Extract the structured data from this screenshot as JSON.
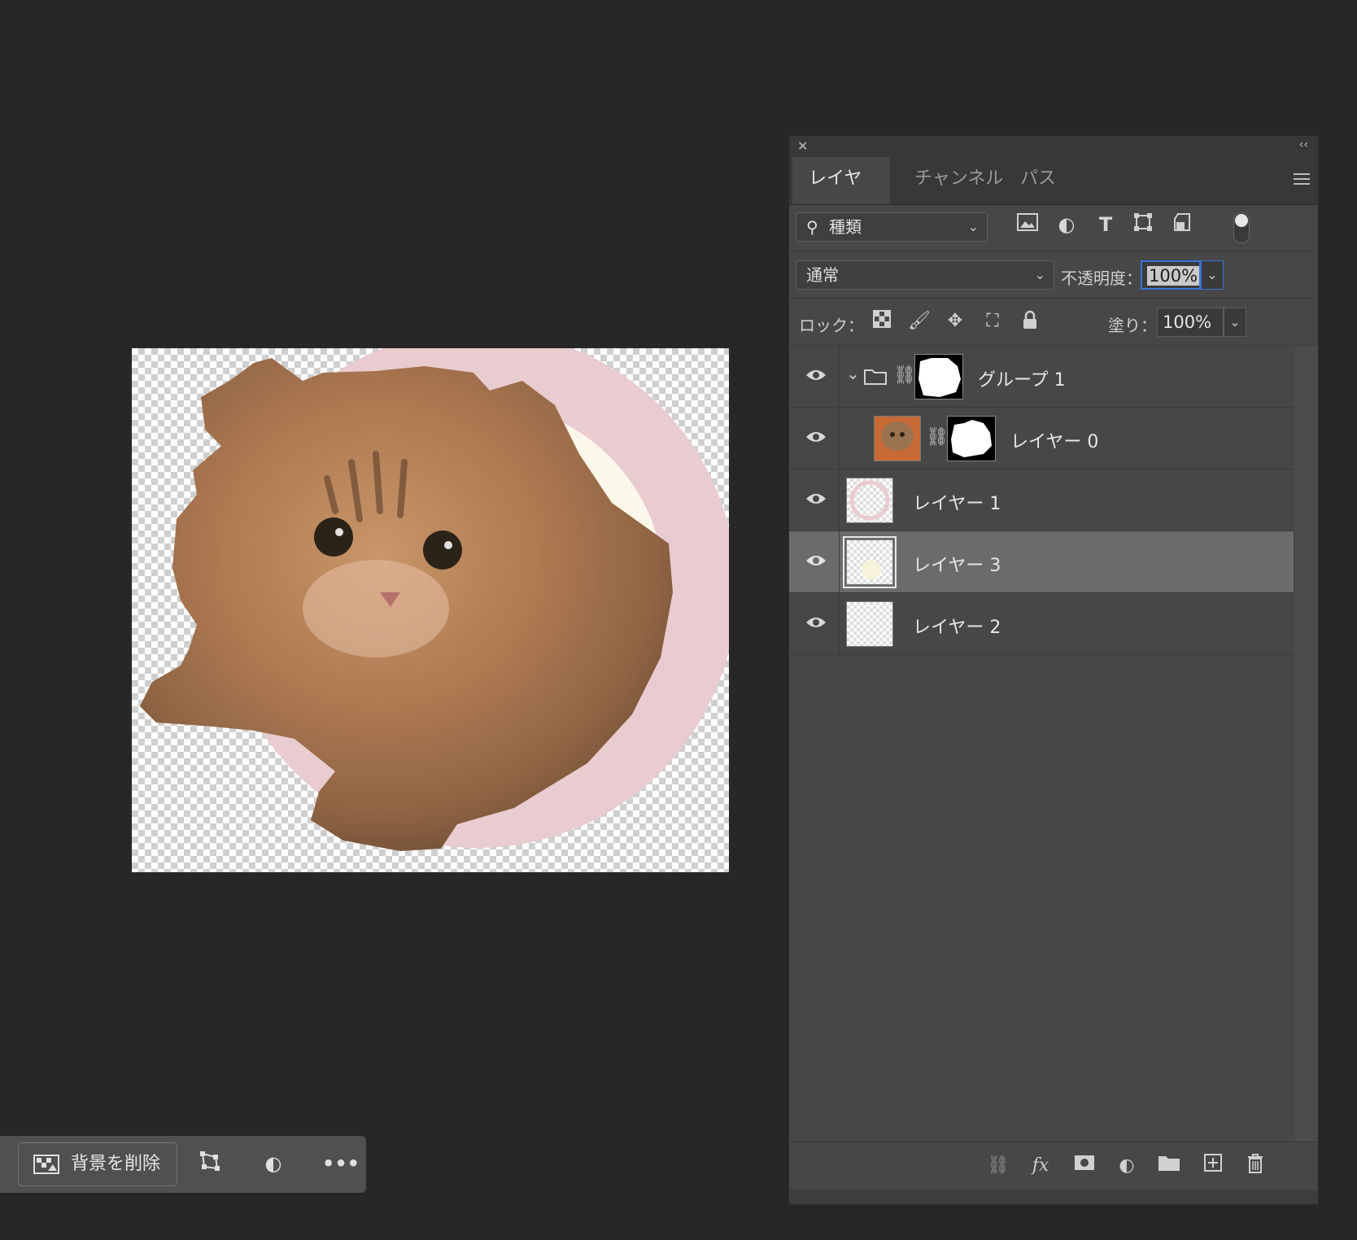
{
  "panel": {
    "tabs": [
      {
        "label": "レイヤー",
        "active": true
      },
      {
        "label": "チャンネル",
        "active": false
      },
      {
        "label": "パス",
        "active": false
      }
    ],
    "filter": {
      "kind_label": "種類"
    },
    "blend_mode": "通常",
    "opacity_label": "不透明度：",
    "opacity_value": "100%",
    "lock_label": "ロック：",
    "fill_label": "塗り：",
    "fill_value": "100%",
    "layers": [
      {
        "name": "グループ 1",
        "type": "group",
        "expanded": true,
        "visible": true,
        "selected": false
      },
      {
        "name": "レイヤー 0",
        "type": "pixel-with-mask",
        "visible": true,
        "selected": false,
        "indented": true
      },
      {
        "name": "レイヤー 1",
        "type": "pixel",
        "visible": true,
        "selected": false
      },
      {
        "name": "レイヤー 3",
        "type": "pixel",
        "visible": true,
        "selected": true
      },
      {
        "name": "レイヤー 2",
        "type": "pixel",
        "visible": true,
        "selected": false
      }
    ]
  },
  "taskbar": {
    "remove_bg_label": "背景を削除"
  },
  "colors": {
    "ring": "#e9ccd0",
    "selection_outline": "#3b73d6",
    "panel_bg": "#474747",
    "app_bg": "#272727"
  }
}
